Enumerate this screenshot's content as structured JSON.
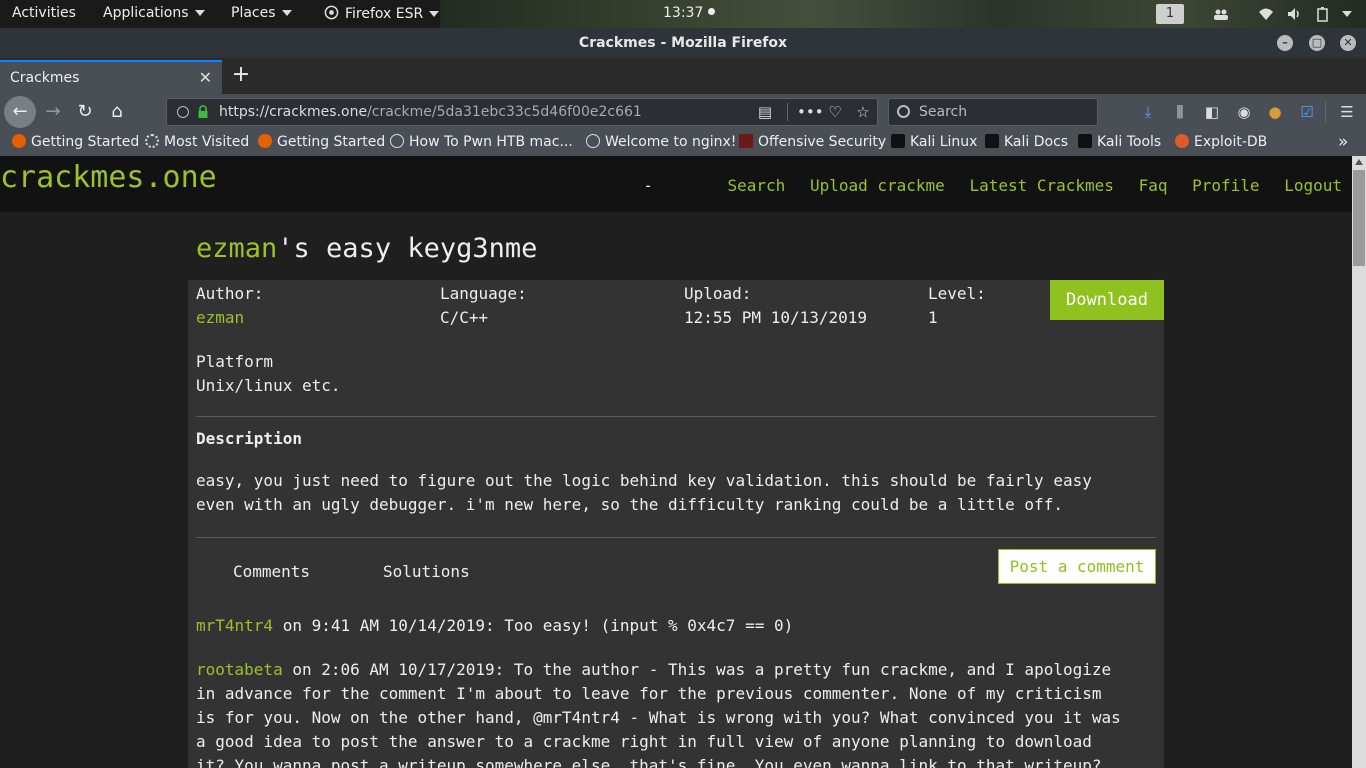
{
  "topbar": {
    "activities": "Activities",
    "applications": "Applications",
    "places": "Places",
    "app": "Firefox ESR",
    "clock": "13:37",
    "workspace": "1"
  },
  "window": {
    "title": "Crackmes - Mozilla Firefox"
  },
  "tabs": [
    {
      "label": "Crackmes"
    }
  ],
  "urlbar": {
    "url_host": "https://crackmes.one",
    "url_path": "/crackme/5da31ebc33c5d46f00e2c661"
  },
  "search": {
    "placeholder": "Search"
  },
  "bookmarks": [
    {
      "label": "Getting Started"
    },
    {
      "label": "Most Visited"
    },
    {
      "label": "Getting Started"
    },
    {
      "label": "How To Pwn HTB mac..."
    },
    {
      "label": "Welcome to nginx!"
    },
    {
      "label": "Offensive Security"
    },
    {
      "label": "Kali Linux"
    },
    {
      "label": "Kali Docs"
    },
    {
      "label": "Kali Tools"
    },
    {
      "label": "Exploit-DB"
    }
  ],
  "site": {
    "logo": "crackmes.one",
    "nav": {
      "dash": "-",
      "search": "Search",
      "upload": "Upload crackme",
      "latest": "Latest Crackmes",
      "faq": "Faq",
      "profile": "Profile",
      "logout": "Logout"
    }
  },
  "crackme": {
    "author": "ezman",
    "title_rest": "'s easy keyg3nme",
    "author_label": "Author:",
    "language_label": "Language:",
    "language": "C/C++",
    "upload_label": "Upload:",
    "upload": "12:55 PM 10/13/2019",
    "level_label": "Level:",
    "level": "1",
    "download": "Download",
    "platform_label": "Platform",
    "platform": "Unix/linux etc.",
    "description_label": "Description",
    "description_line1": "easy, you just need to figure out the logic behind key validation. this should be fairly easy",
    "description_line2": "even with an ugly debugger. i'm new here, so the difficulty ranking could be a little off."
  },
  "tabs_section": {
    "comments": "Comments",
    "solutions": "Solutions",
    "post": "Post a comment"
  },
  "comments": [
    {
      "user": "mrT4ntr4",
      "text": " on 9:41 AM 10/14/2019: Too easy! (input % 0x4c7 == 0)"
    },
    {
      "user": "rootabeta",
      "line1": " on 2:06 AM 10/17/2019: To the author - This was a pretty fun crackme, and I apologize",
      "line2": "in advance for the comment I'm about to leave for the previous commenter. None of my criticism",
      "line3": "is for you. Now on the other hand, @mrT4ntr4 - What is wrong with you? What convinced you it was",
      "line4": "a good idea to post the answer to a crackme right in full view of anyone planning to download",
      "line5": "it? You wanna post a writeup somewhere else, that's fine. You even wanna link to that writeup?"
    }
  ]
}
